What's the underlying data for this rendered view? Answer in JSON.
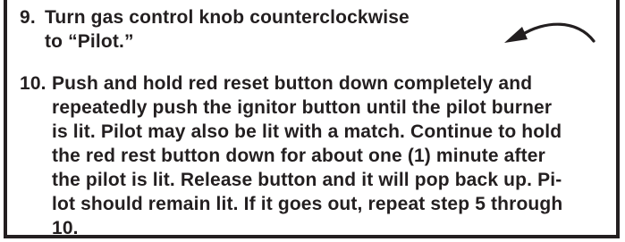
{
  "colors": {
    "text": "#231f20",
    "border": "#231f20",
    "background": "#ffffff"
  },
  "step9": {
    "number": "9.",
    "lines": [
      "Turn gas control knob counterclockwise",
      "to “Pilot.”"
    ]
  },
  "step10": {
    "number": "10.",
    "lines": [
      "Push and hold red reset button down completely and",
      "repeatedly push the ignitor button until the pilot burner",
      "is lit. Pilot may also be lit with a match. Continue to hold",
      "the red rest button down for about one (1) minute after",
      "the pilot is lit. Release button and it will pop back up. Pi-",
      "lot should remain lit. If it goes out, repeat step 5 through",
      "10."
    ]
  },
  "icons": {
    "arrow": "counterclockwise-arrow-icon"
  }
}
